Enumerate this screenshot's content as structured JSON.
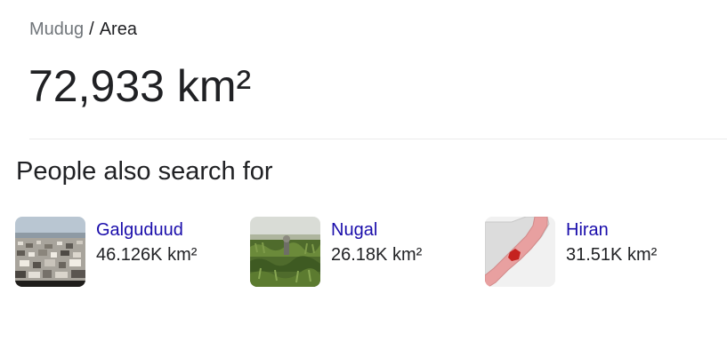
{
  "breadcrumb": {
    "parent": "Mudug",
    "separator": "/",
    "current": "Area"
  },
  "answer": {
    "value": "72,933 km²"
  },
  "related": {
    "title": "People also search for",
    "items": [
      {
        "name": "Galguduud",
        "value": "46.126K km²",
        "thumbnail": "city-aerial-photo"
      },
      {
        "name": "Nugal",
        "value": "26.18K km²",
        "thumbnail": "grassland-photo"
      },
      {
        "name": "Hiran",
        "value": "31.51K km²",
        "thumbnail": "somalia-region-map"
      }
    ]
  },
  "colors": {
    "link": "#1a0dab",
    "text": "#202124",
    "muted": "#70757a",
    "divider": "#ebebeb",
    "map_highlight": "#e8a0a0",
    "map_marker": "#c5221f"
  }
}
